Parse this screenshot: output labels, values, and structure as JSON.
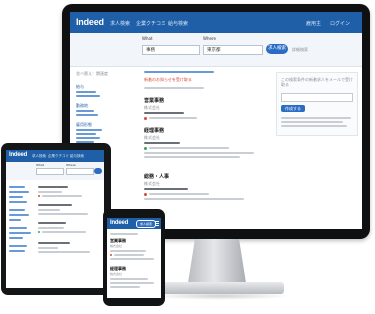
{
  "brand": {
    "logo": "Indeed",
    "colors": {
      "primary": "#1f5fa8",
      "button": "#2b6cc4",
      "bezel": "#0f1012",
      "background": "#ffffff",
      "alert_red": "#d64a3a",
      "success_green": "#3aa05a"
    }
  },
  "desktop": {
    "nav": {
      "items": [
        "求人検索",
        "企業クチコミ",
        "給与検索"
      ],
      "right_items": [
        "雇用主",
        "ログイン"
      ]
    },
    "search": {
      "what_label": "What",
      "where_label": "Where",
      "what_value": "事務",
      "where_value": "東京都",
      "button_label": "求人検索",
      "advanced_link": "詳細検索"
    },
    "sidebar": {
      "title_sort": "並べ替え：関連度",
      "filter_headers": [
        "給与",
        "勤務地",
        "雇用形態",
        "会社",
        "経験"
      ]
    },
    "results": {
      "notice": "新着のお知らせを受け取る",
      "count_text": "事務の求人 - 東京都",
      "jobs": [
        {
          "title": "営業事務",
          "company": "株式会社",
          "location": "東京都"
        },
        {
          "title": "経理事務",
          "company": "株式会社",
          "location": "東京都 港区"
        },
        {
          "title": "総務・人事",
          "company": "株式会社",
          "location": "東京都"
        }
      ]
    },
    "right_panel": {
      "heading": "この検索条件の新着求人をメールで受け取る",
      "button_label": "作成する"
    }
  },
  "tablet": {
    "nav": {
      "items": [
        "求人検索",
        "企業クチコミ",
        "給与検索"
      ]
    },
    "search": {
      "what_label": "What",
      "where_label": "Where"
    }
  },
  "phone": {
    "search_button": "求人検索",
    "menu_icon": "hamburger-icon",
    "jobs": [
      {
        "title": "営業事務",
        "company": "株式会社"
      },
      {
        "title": "経理事務",
        "company": "株式会社"
      }
    ]
  }
}
